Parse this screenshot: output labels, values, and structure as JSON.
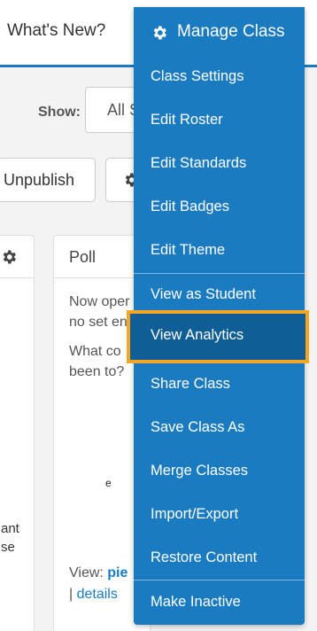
{
  "header": {
    "whats_new": "What's New?"
  },
  "toolbar": {
    "show_label": "Show:",
    "show_value": "All S",
    "unpublish_label": "Unpublish"
  },
  "left_panel": {
    "text_line1": "ant",
    "text_line2": "se"
  },
  "poll": {
    "title": "Poll",
    "line1": "Now oper",
    "line2": "no set en",
    "line3": "What co",
    "line4": "been to?",
    "pie_label": "e",
    "view_prefix": "View: ",
    "view_link": "pie",
    "details_prefix": "| ",
    "details_link": "details"
  },
  "menu": {
    "title": "Manage Class",
    "items": [
      {
        "label": "Class Settings"
      },
      {
        "label": "Edit Roster"
      },
      {
        "label": "Edit Standards"
      },
      {
        "label": "Edit Badges"
      },
      {
        "label": "Edit Theme"
      },
      {
        "label": "View as Student"
      },
      {
        "label": "View Analytics",
        "highlighted": true
      },
      {
        "label": "Share Class"
      },
      {
        "label": "Save Class As"
      },
      {
        "label": "Merge Classes"
      },
      {
        "label": "Import/Export"
      },
      {
        "label": "Restore Content"
      },
      {
        "label": "Make Inactive"
      }
    ]
  },
  "colors": {
    "menu_background": "#1a7bc0",
    "menu_active": "#0f5e95",
    "highlight_border": "#f5a623",
    "pie_green": "#3aa53a",
    "link": "#1a7bc0"
  }
}
